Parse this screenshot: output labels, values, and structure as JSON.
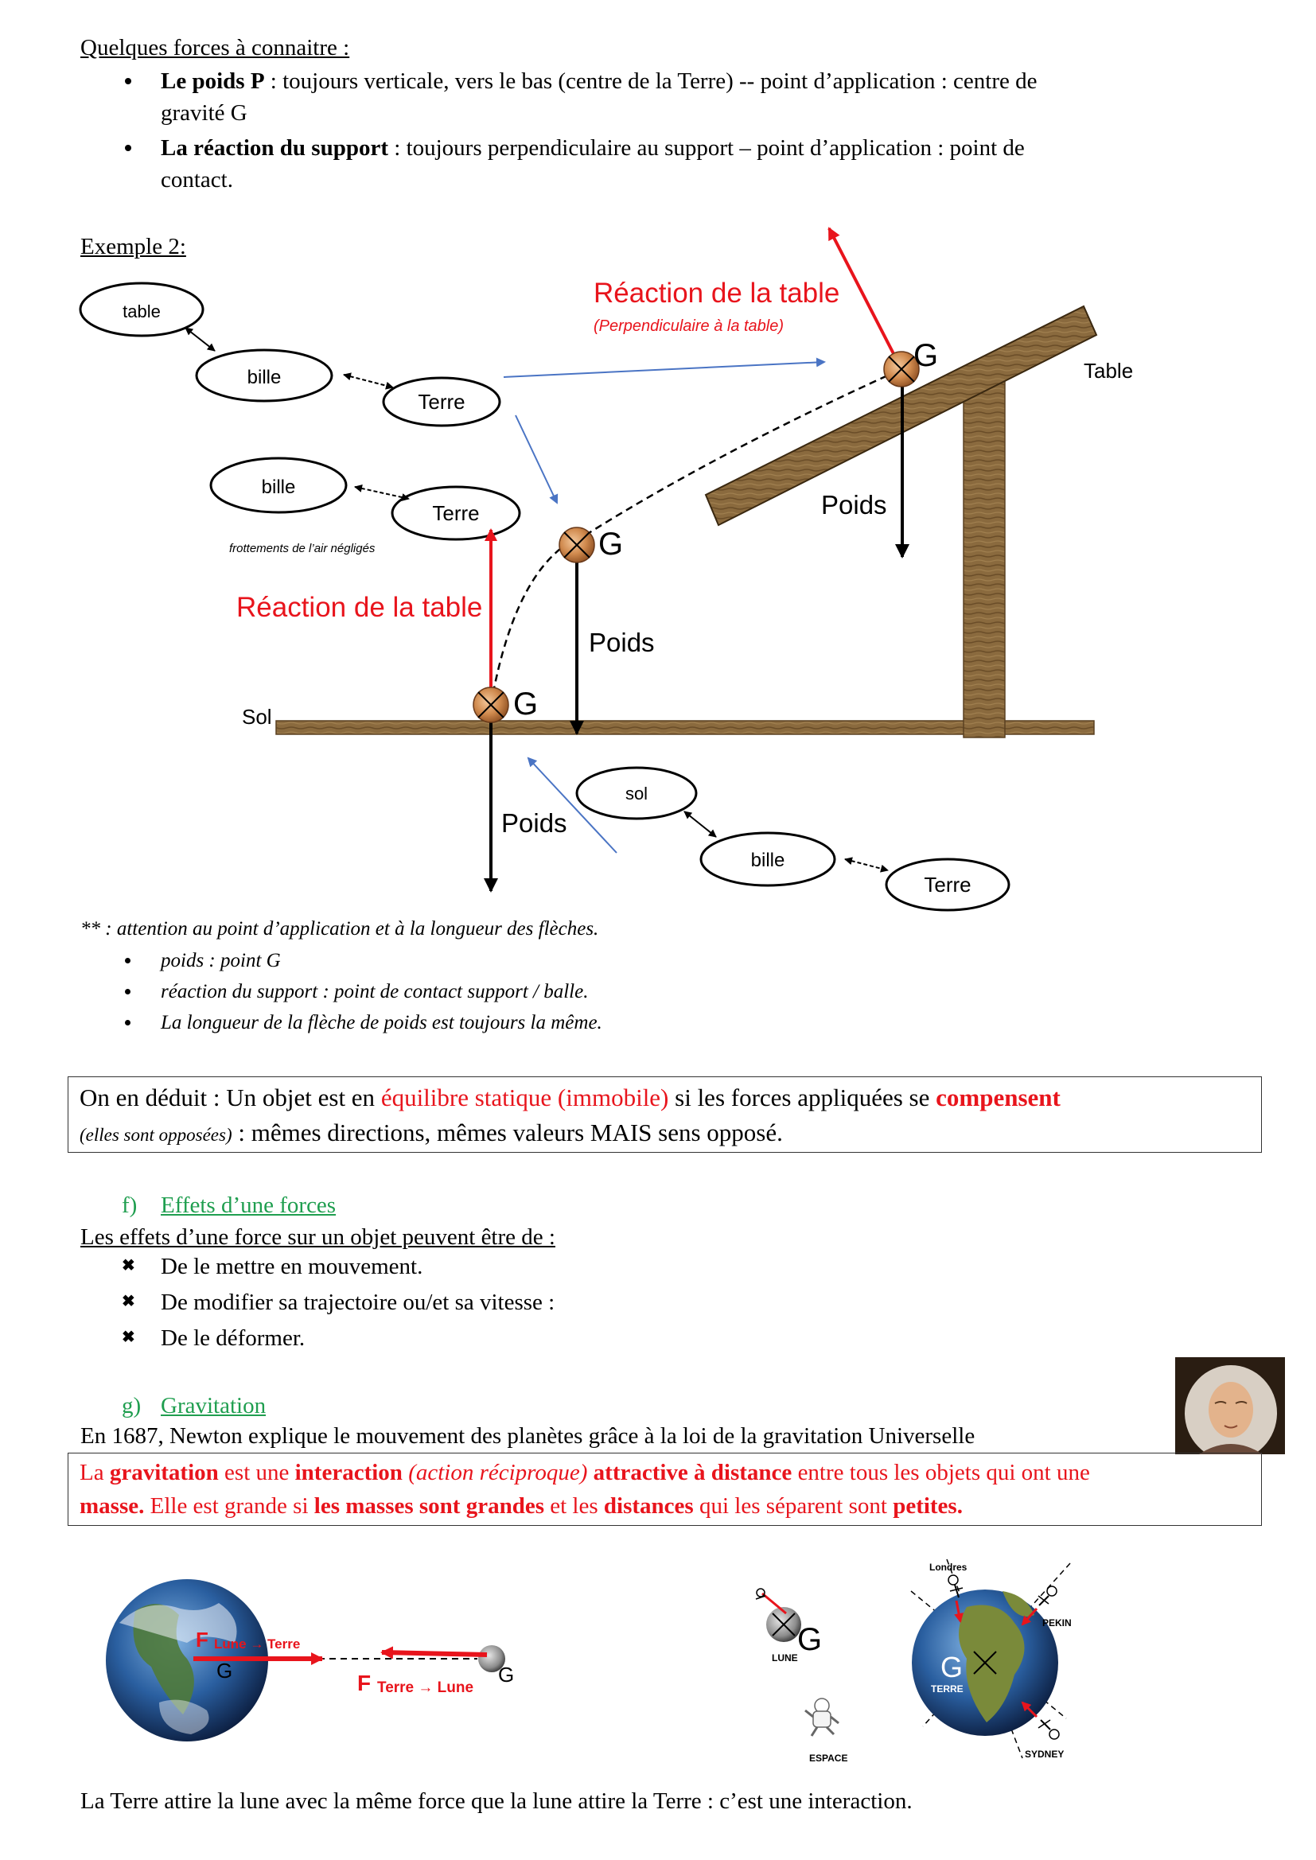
{
  "intro": {
    "heading": "Quelques forces à connaitre :",
    "items": [
      {
        "bold": "Le poids P",
        "line1": " : toujours verticale, vers le bas (centre de la Terre)  -- point d’application : centre de",
        "line2": "gravité G"
      },
      {
        "bold": "La réaction du support",
        "line1": " : toujours perpendiculaire au support – point d’application :  point de",
        "line2": "contact."
      }
    ]
  },
  "example": {
    "heading": "Exemple 2:",
    "bubbles": {
      "table": "table",
      "bille": "bille",
      "terre": "Terre",
      "sol": "sol"
    },
    "labels": {
      "reaction_table": "Réaction de la table",
      "perpendiculaire": "(Perpendiculaire à la table)",
      "table": "Table",
      "poids": "Poids",
      "g": "G",
      "sol": "Sol",
      "frottements": "frottements de l’air négligés"
    },
    "colors": {
      "reaction": "#e8141c",
      "wood": "#8a6a3e",
      "link": "#4a74c4"
    }
  },
  "notes": {
    "intro": "** : attention au point d’application et à la longueur des flèches.",
    "items": [
      "poids : point G",
      "réaction du support : point de contact support / balle.",
      "La longueur de la flèche de poids est toujours la même."
    ]
  },
  "deduction": {
    "part1": "On en déduit : Un objet est en ",
    "red1": "équilibre statique (immobile)",
    "part2": " si les forces appliquées se ",
    "bold_red": "compensent",
    "small": "(elles sont opposées)",
    "part3": " : mêmes directions, mêmes valeurs MAIS sens opposé."
  },
  "effects": {
    "letter": "f)",
    "title": "Effets d’une forces",
    "intro": "Les effets d’une force sur un objet peuvent être de :",
    "items": [
      "De le mettre en mouvement.",
      "De modifier sa trajectoire ou/et sa vitesse :",
      "De le déformer."
    ]
  },
  "gravitation": {
    "letter": "g)",
    "title": "Gravitation",
    "intro": "En 1687, Newton explique le mouvement des planètes grâce à la loi de la gravitation Universelle",
    "def": {
      "s1": "La ",
      "b1": "gravitation",
      "s2": " est une ",
      "b2": "interaction",
      "i1": " (action réciproque) ",
      "b3": "attractive à distance",
      "s3": " entre tous les objets qui ont une",
      "b4": "masse.",
      "s4": " Elle est grande si ",
      "b5": "les masses sont grandes",
      "s5": " et les ",
      "b6": "distances",
      "s6": " qui les séparent sont ",
      "b7": "petites."
    },
    "figure": {
      "f": "F",
      "lune_terre": "Lune → Terre",
      "terre_lune": "Terre → Lune",
      "g": "G",
      "lune": "LUNE",
      "terre": "TERRE",
      "espace": "ESPACE",
      "londres": "Londres",
      "pekin": "PEKIN",
      "sydney": "SYDNEY"
    },
    "conclusion": "La Terre attire la lune avec la même force que la lune attire la Terre : c’est une interaction."
  }
}
